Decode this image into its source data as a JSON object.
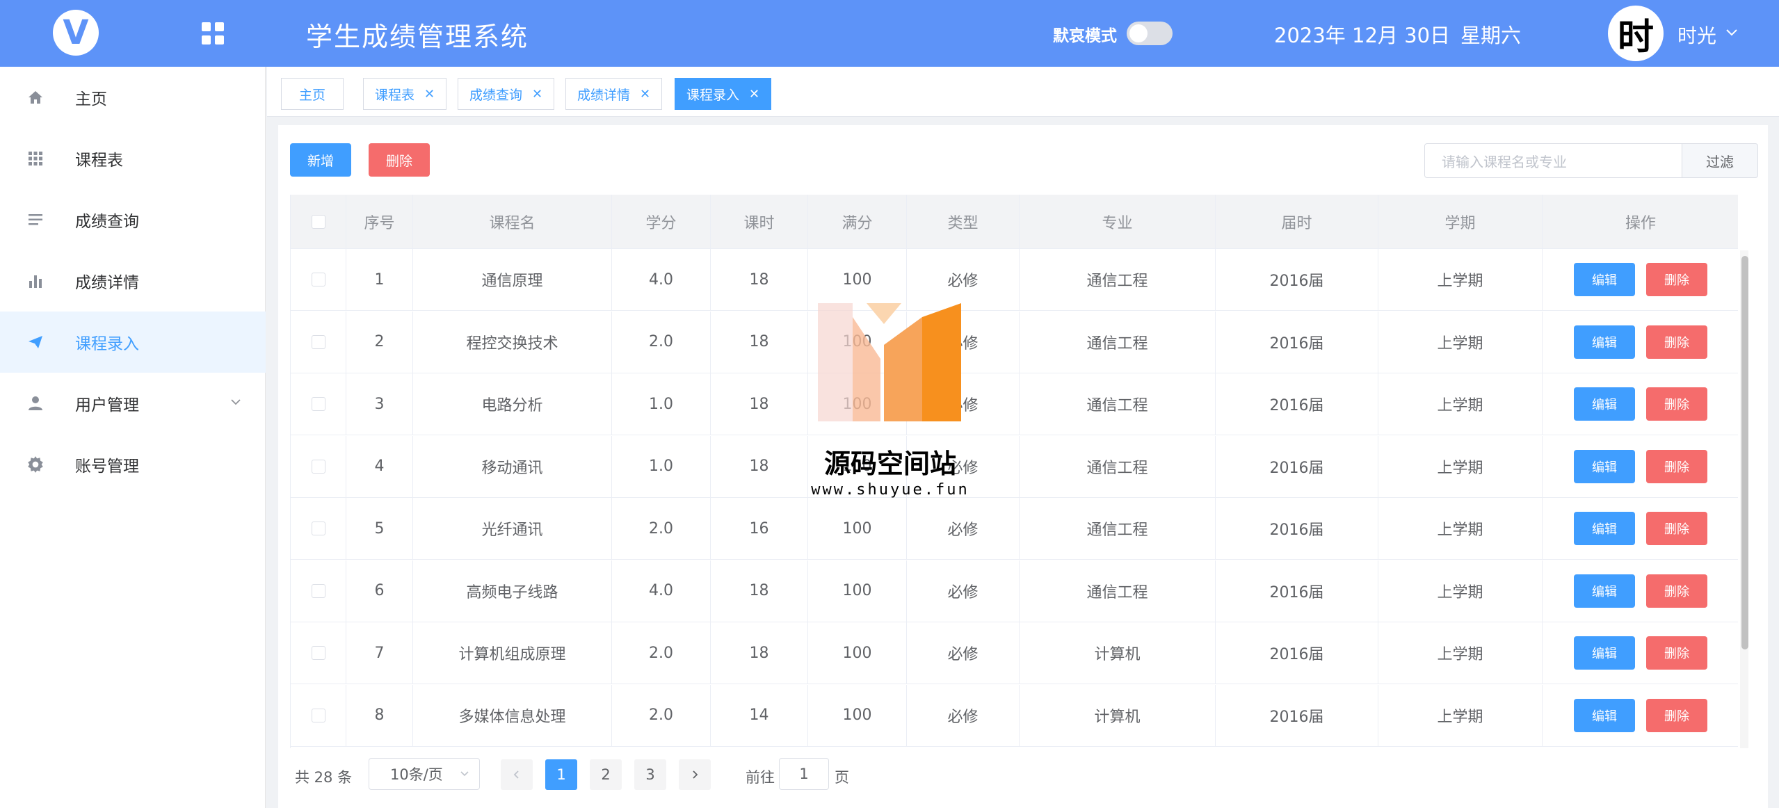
{
  "header": {
    "title": "学生成绩管理系统",
    "dark_mode_label": "默哀模式",
    "date": "2023年 12月 30日",
    "weekday": "星期六",
    "avatar_char": "时",
    "username": "时光",
    "accent_color": "#5d93f8"
  },
  "sidebar": {
    "items": [
      {
        "label": "主页",
        "icon": "home-icon"
      },
      {
        "label": "课程表",
        "icon": "grid-icon"
      },
      {
        "label": "成绩查询",
        "icon": "list-icon"
      },
      {
        "label": "成绩详情",
        "icon": "bar-chart-icon"
      },
      {
        "label": "课程录入",
        "icon": "send-icon",
        "active": true
      },
      {
        "label": "用户管理",
        "icon": "user-icon",
        "expandable": true
      },
      {
        "label": "账号管理",
        "icon": "gear-icon"
      }
    ]
  },
  "tabs": [
    {
      "label": "主页",
      "closable": false
    },
    {
      "label": "课程表",
      "closable": true
    },
    {
      "label": "成绩查询",
      "closable": true
    },
    {
      "label": "成绩详情",
      "closable": true
    },
    {
      "label": "课程录入",
      "closable": true,
      "active": true
    }
  ],
  "toolbar": {
    "add_label": "新增",
    "delete_label": "删除",
    "search_placeholder": "请输入课程名或专业",
    "filter_label": "过滤"
  },
  "table": {
    "headers": [
      "序号",
      "课程名",
      "学分",
      "课时",
      "满分",
      "类型",
      "专业",
      "届时",
      "学期",
      "操作"
    ],
    "edit_label": "编辑",
    "delete_label": "删除",
    "rows": [
      [
        "1",
        "通信原理",
        "4.0",
        "18",
        "100",
        "必修",
        "通信工程",
        "2016届",
        "上学期"
      ],
      [
        "2",
        "程控交换技术",
        "2.0",
        "18",
        "100",
        "必修",
        "通信工程",
        "2016届",
        "上学期"
      ],
      [
        "3",
        "电路分析",
        "1.0",
        "18",
        "100",
        "必修",
        "通信工程",
        "2016届",
        "上学期"
      ],
      [
        "4",
        "移动通讯",
        "1.0",
        "18",
        "100",
        "必修",
        "通信工程",
        "2016届",
        "上学期"
      ],
      [
        "5",
        "光纤通讯",
        "2.0",
        "16",
        "100",
        "必修",
        "通信工程",
        "2016届",
        "上学期"
      ],
      [
        "6",
        "高频电子线路",
        "4.0",
        "18",
        "100",
        "必修",
        "通信工程",
        "2016届",
        "上学期"
      ],
      [
        "7",
        "计算机组成原理",
        "2.0",
        "18",
        "100",
        "必修",
        "计算机",
        "2016届",
        "上学期"
      ],
      [
        "8",
        "多媒体信息处理",
        "2.0",
        "14",
        "100",
        "必修",
        "计算机",
        "2016届",
        "上学期"
      ]
    ]
  },
  "pagination": {
    "total_text": "共 28 条",
    "page_size": "10条/页",
    "pages": [
      "1",
      "2",
      "3"
    ],
    "current_page": "1",
    "goto_label": "前往",
    "goto_value": "1",
    "page_suffix": "页"
  },
  "watermark": {
    "text": "源码空间站",
    "url": "www.shuyue.fun"
  }
}
